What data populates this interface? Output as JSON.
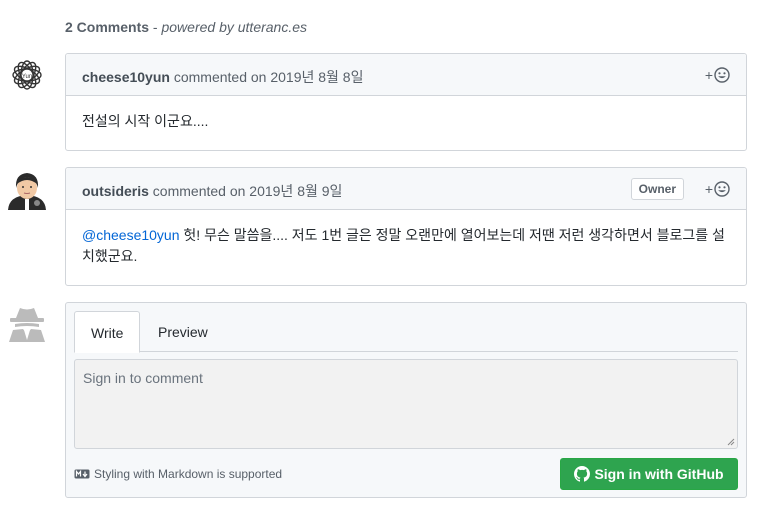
{
  "header": {
    "count": "2 Comments",
    "separator": " - ",
    "powered": "powered by utteranc.es"
  },
  "comments": [
    {
      "author": "cheese10yun",
      "meta": " commented on 2019년 8월 8일",
      "body": "전설의 시작 이군요....",
      "react_plus": "+"
    },
    {
      "author": "outsideris",
      "meta": " commented on 2019년 8월 9일",
      "badge": "Owner",
      "mention": "@cheese10yun",
      "body": " 헛! 무슨 말씀을.... 저도 1번 글은 정말 오랜만에 열어보는데 저땐 저런 생각하면서 블로그를 설치했군요.",
      "react_plus": "+"
    }
  ],
  "editor": {
    "tabs": [
      "Write",
      "Preview"
    ],
    "placeholder": "Sign in to comment",
    "markdown_note": "Styling with Markdown is supported",
    "signin_label": "Sign in with GitHub"
  },
  "colors": {
    "accent_green": "#2ea44f",
    "link_blue": "#0366d6",
    "border": "#d1d5da",
    "header_bg": "#f6f8fa"
  },
  "icons": [
    "yun-logo-avatar",
    "outsideris-avatar",
    "anonymous-avatar",
    "smiley-icon",
    "markdown-icon",
    "github-icon"
  ]
}
